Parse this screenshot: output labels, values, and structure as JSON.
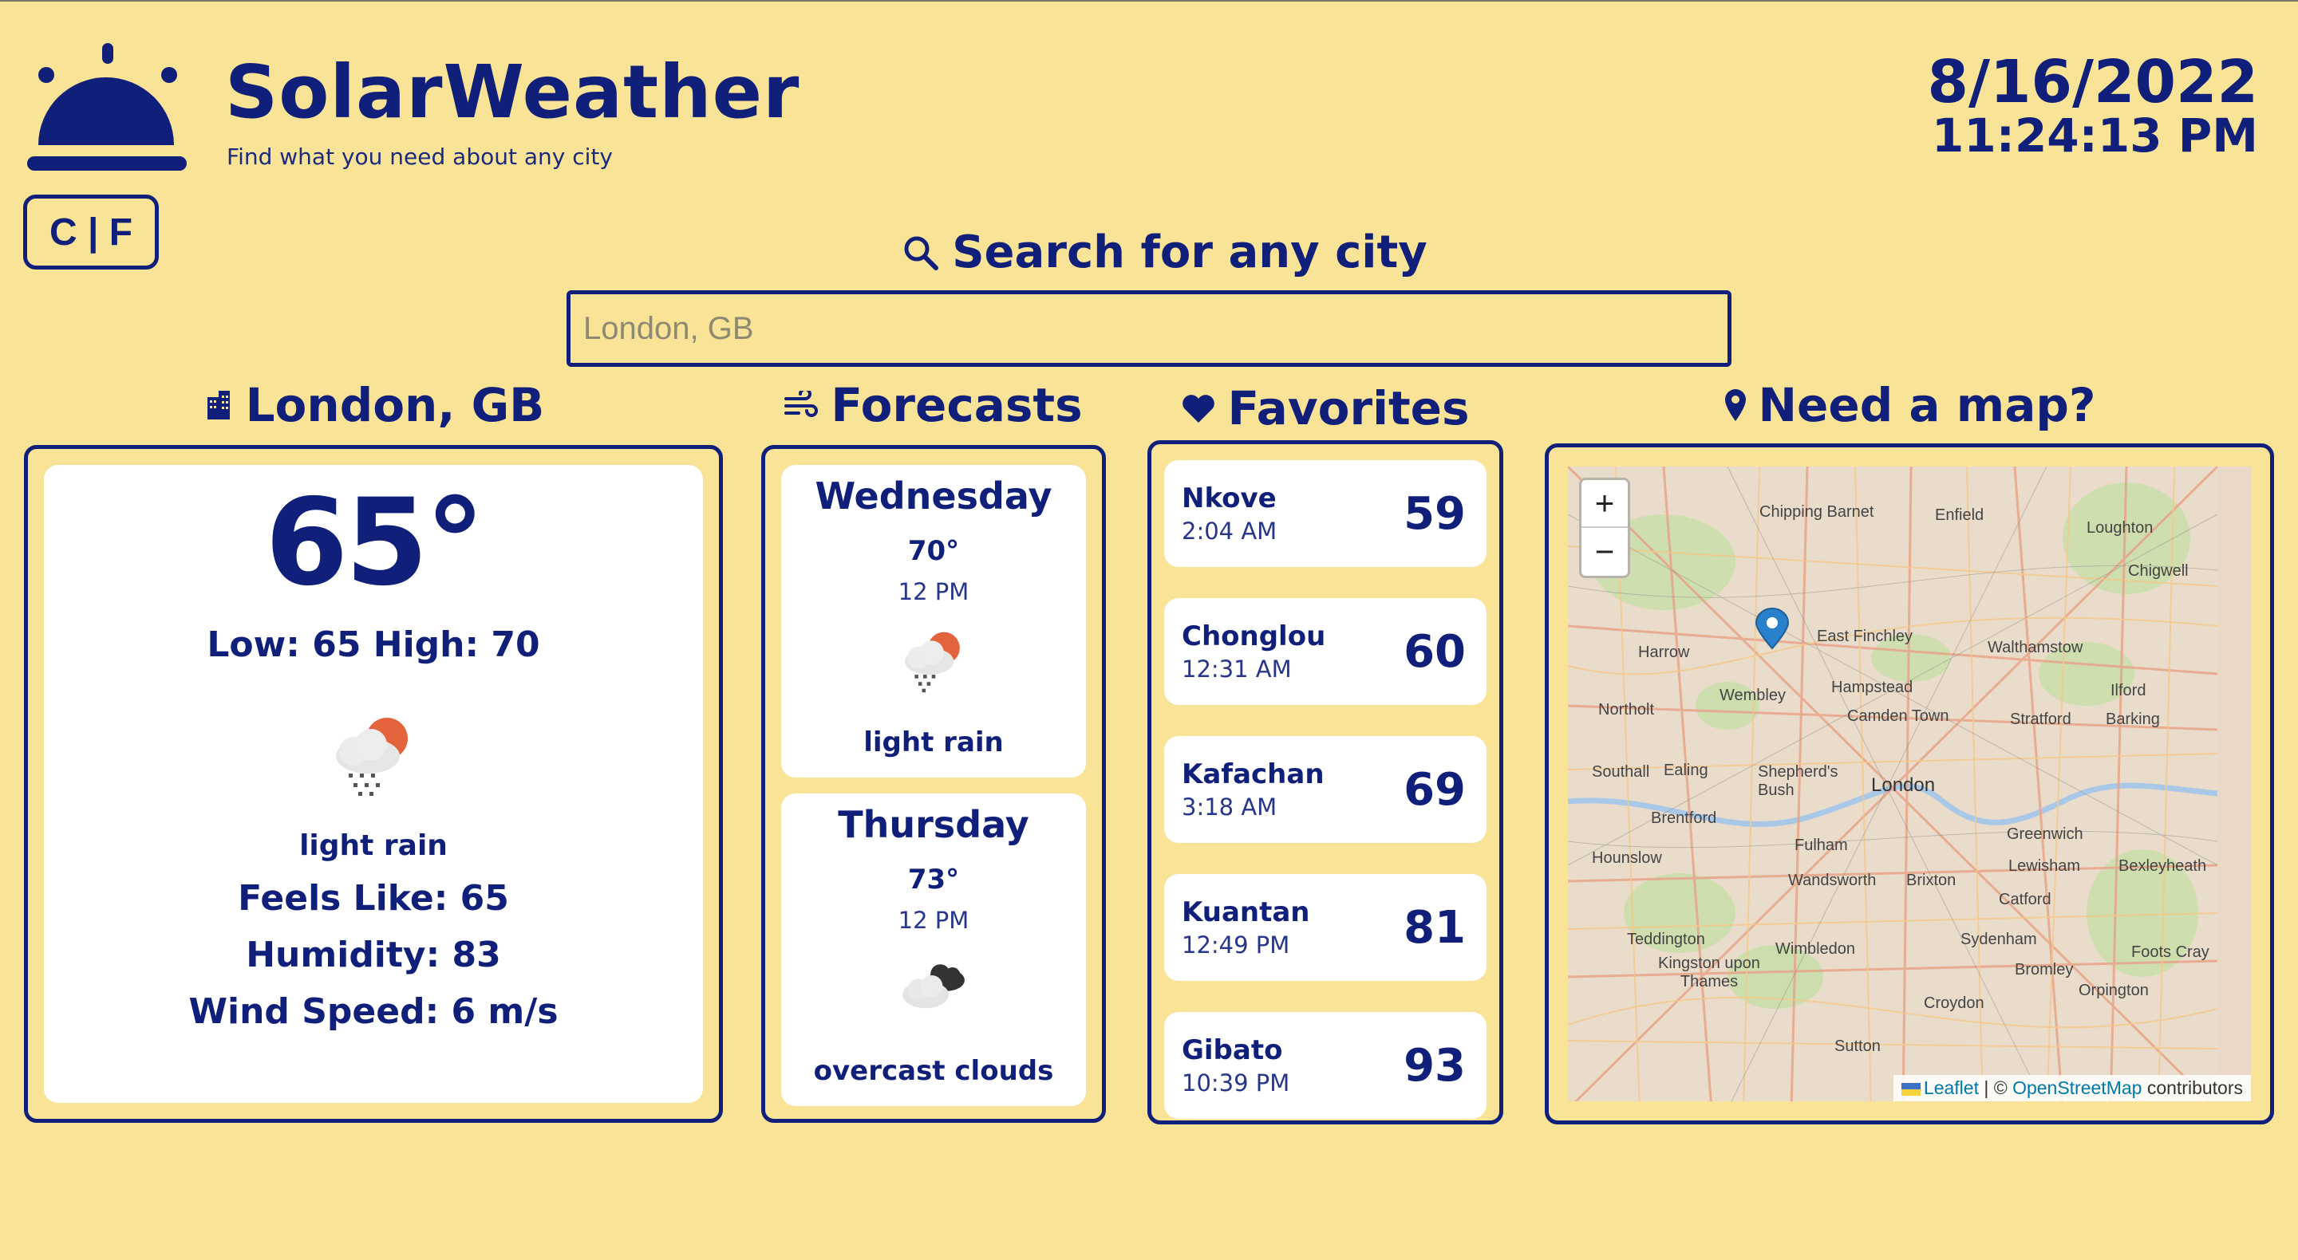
{
  "header": {
    "app_title": "SolarWeather",
    "tagline": "Find what you need about any city",
    "unit_toggle": "C | F",
    "date": "8/16/2022",
    "time": "11:24:13 PM"
  },
  "search": {
    "heading": "Search for any city",
    "placeholder": "London, GB"
  },
  "current": {
    "heading": "London, GB",
    "temp": "65°",
    "low_high": "Low: 65 High: 70",
    "icon": "rain-sun-icon",
    "description": "light rain",
    "feels_like": "Feels Like: 65",
    "humidity": "Humidity: 83",
    "wind_speed": "Wind Speed: 6 m/s"
  },
  "forecasts": {
    "heading": "Forecasts",
    "items": [
      {
        "day": "Wednesday",
        "temp": "70°",
        "time": "12 PM",
        "icon": "rain-sun-icon",
        "description": "light rain"
      },
      {
        "day": "Thursday",
        "temp": "73°",
        "time": "12 PM",
        "icon": "overcast-clouds-icon",
        "description": "overcast clouds"
      }
    ]
  },
  "favorites": {
    "heading": "Favorites",
    "items": [
      {
        "city": "Nkove",
        "time": "2:04 AM",
        "temp": "59"
      },
      {
        "city": "Chonglou",
        "time": "12:31 AM",
        "temp": "60"
      },
      {
        "city": "Kafachan",
        "time": "3:18 AM",
        "temp": "69"
      },
      {
        "city": "Kuantan",
        "time": "12:49 PM",
        "temp": "81"
      },
      {
        "city": "Gibato",
        "time": "10:39 PM",
        "temp": "93"
      }
    ]
  },
  "map": {
    "heading": "Need a map?",
    "zoom_in": "+",
    "zoom_out": "−",
    "attribution_leaflet": "Leaflet",
    "attribution_sep": " | © ",
    "attribution_osm": "OpenStreetMap",
    "attribution_tail": " contributors",
    "labels": [
      "Chipping Barnet",
      "Enfield",
      "Loughton",
      "Chigwell",
      "East Finchley",
      "Walthamstow",
      "Harrow",
      "Wembley",
      "Hampstead",
      "Northolt",
      "Camden Town",
      "Stratford",
      "Ilford",
      "Barking",
      "Southall",
      "Ealing",
      "Shepherd's Bush",
      "London",
      "Brentford",
      "Fulham",
      "Greenwich",
      "Hounslow",
      "Wandsworth",
      "Brixton",
      "Lewisham",
      "Bexleyheath",
      "Catford",
      "Teddington",
      "Kingston upon Thames",
      "Wimbledon",
      "Sydenham",
      "Bromley",
      "Foots Cray",
      "Croydon",
      "Orpington",
      "Sutton"
    ]
  },
  "colors": {
    "background": "#f9e397",
    "accent": "#0f1f7a",
    "card": "#ffffff"
  }
}
